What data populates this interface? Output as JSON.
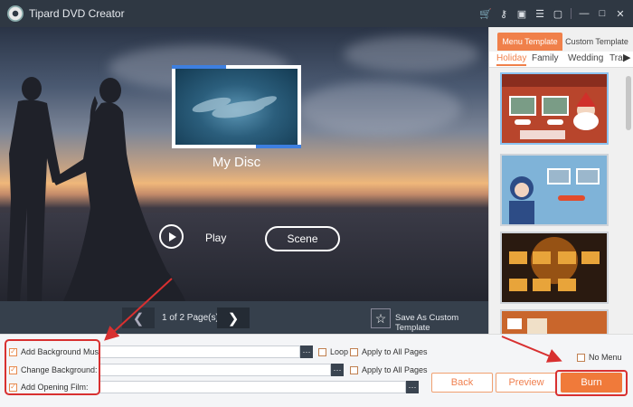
{
  "app": {
    "title": "Tipard DVD Creator",
    "titlebar_icons": [
      "cart-icon",
      "key-icon",
      "save-icon",
      "register-icon",
      "feedback-icon",
      "minimize-icon",
      "maximize-icon",
      "close-icon"
    ]
  },
  "preview": {
    "disc_title": "My Disc",
    "play_label": "Play",
    "scene_label": "Scene"
  },
  "pager": {
    "page_text": "1 of 2 Page(s)",
    "save_template_label": "Save As Custom Template"
  },
  "templates": {
    "tabs": [
      "Menu Template",
      "Custom Template"
    ],
    "categories": [
      "Holiday",
      "Family",
      "Wedding",
      "Tra"
    ],
    "selected_category": "Holiday"
  },
  "settings": {
    "bg_music_label": "Add Background Music:",
    "change_bg_label": "Change Background:",
    "opening_film_label": "Add Opening Film:",
    "dots": "···",
    "loop_label": "Loop",
    "apply_all_label": "Apply to All Pages",
    "apply_all_label_2": "Apply to All Pages",
    "no_menu_label": "No Menu"
  },
  "buttons": {
    "back": "Back",
    "preview": "Preview",
    "burn": "Burn"
  },
  "colors": {
    "accent": "#f07a3a",
    "annotation": "#d83030",
    "titlebar": "#2f3843"
  }
}
